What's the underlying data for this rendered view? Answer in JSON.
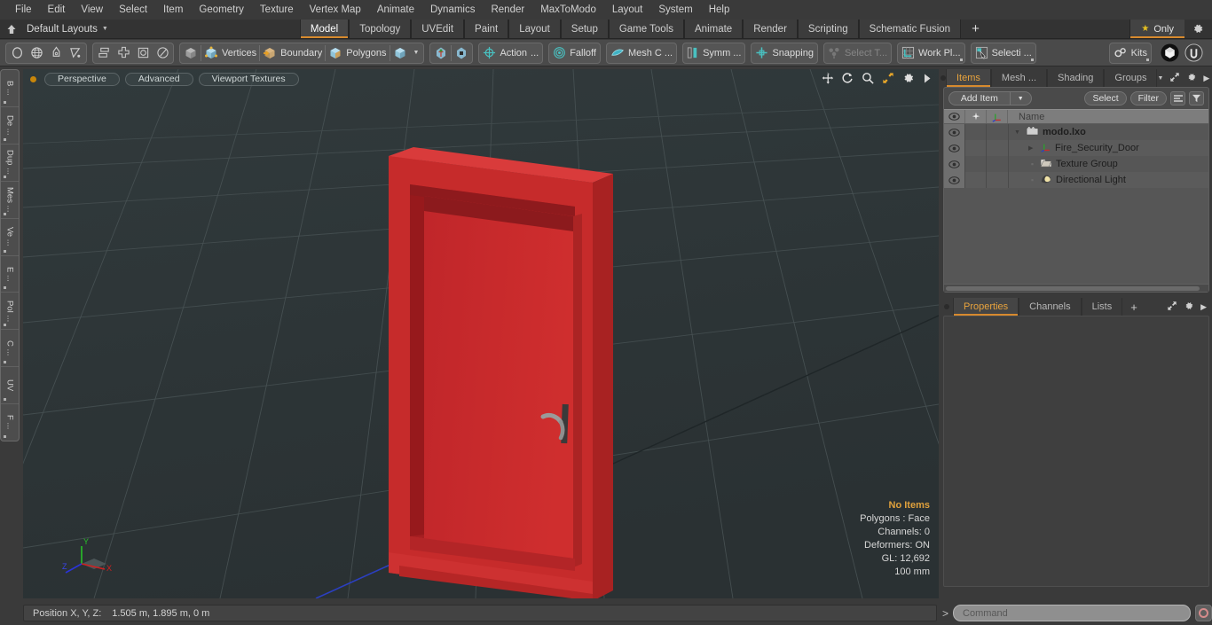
{
  "app": {
    "title": "modo",
    "accent": "#d78a2e",
    "viewport_bg": "#2e3638",
    "model_red": "#cc2a2a"
  },
  "menubar": {
    "items": [
      {
        "label": "File"
      },
      {
        "label": "Edit"
      },
      {
        "label": "View"
      },
      {
        "label": "Select"
      },
      {
        "label": "Item"
      },
      {
        "label": "Geometry"
      },
      {
        "label": "Texture"
      },
      {
        "label": "Vertex Map"
      },
      {
        "label": "Animate"
      },
      {
        "label": "Dynamics"
      },
      {
        "label": "Render"
      },
      {
        "label": "MaxToModo"
      },
      {
        "label": "Layout"
      },
      {
        "label": "System"
      },
      {
        "label": "Help"
      }
    ]
  },
  "layoutbar": {
    "layouts_label": "Default Layouts",
    "tabs": [
      {
        "label": "Model",
        "active": true
      },
      {
        "label": "Topology",
        "active": false
      },
      {
        "label": "UVEdit",
        "active": false
      },
      {
        "label": "Paint",
        "active": false
      },
      {
        "label": "Layout",
        "active": false
      },
      {
        "label": "Setup",
        "active": false
      },
      {
        "label": "Game Tools",
        "active": false
      },
      {
        "label": "Animate",
        "active": false
      },
      {
        "label": "Render",
        "active": false
      },
      {
        "label": "Scripting",
        "active": false
      },
      {
        "label": "Schematic Fusion",
        "active": false
      }
    ],
    "add_tab_label": "+",
    "only_label": "Only"
  },
  "toolbar": {
    "shape_tools": [
      {
        "name": "ellipse-tool",
        "label": ""
      },
      {
        "name": "globe-tool",
        "label": ""
      },
      {
        "name": "pen-tool",
        "label": ""
      },
      {
        "name": "curve-tool",
        "label": ""
      }
    ],
    "arrange_tools": [
      {
        "name": "align-tool",
        "label": ""
      },
      {
        "name": "center-tool",
        "label": ""
      },
      {
        "name": "bound-tool",
        "label": ""
      },
      {
        "name": "radial-tool",
        "label": ""
      }
    ],
    "selection_modes": [
      {
        "name": "cube-mode",
        "label": ""
      },
      {
        "name": "vertices-mode",
        "label": "Vertices"
      },
      {
        "name": "boundary-mode",
        "label": "Boundary"
      },
      {
        "name": "polygons-mode",
        "label": "Polygons"
      },
      {
        "name": "items-mode",
        "label": ""
      }
    ],
    "buttons": [
      {
        "name": "action-center",
        "label": "Action",
        "suffix": "...",
        "dim": false
      },
      {
        "name": "falloff",
        "label": "Falloff",
        "suffix": "",
        "dim": false
      },
      {
        "name": "mesh-constraint",
        "label": "Mesh C ...",
        "suffix": "",
        "dim": false
      },
      {
        "name": "symmetry",
        "label": "Symm ...",
        "suffix": "",
        "dim": false
      },
      {
        "name": "snapping",
        "label": "Snapping",
        "suffix": "",
        "dim": false
      },
      {
        "name": "select-through",
        "label": "Select T...",
        "suffix": "",
        "dim": true
      },
      {
        "name": "work-plane",
        "label": "Work Pl...",
        "suffix": "",
        "dim": false
      },
      {
        "name": "selection-set",
        "label": "Selecti ...",
        "suffix": "",
        "dim": false
      },
      {
        "name": "kits",
        "label": "Kits",
        "suffix": "",
        "dim": false
      }
    ],
    "export_unity": "unity-icon",
    "export_unreal": "unreal-icon"
  },
  "left_tabs": [
    {
      "label": "B ..."
    },
    {
      "label": "De ..."
    },
    {
      "label": "Dup ..."
    },
    {
      "label": "Mes ..."
    },
    {
      "label": "Ve ..."
    },
    {
      "label": "E ..."
    },
    {
      "label": "Pol ..."
    },
    {
      "label": "C ..."
    },
    {
      "label": "UV"
    },
    {
      "label": "F ..."
    }
  ],
  "viewport": {
    "pills": [
      {
        "name": "perspective",
        "label": "Perspective"
      },
      {
        "name": "advanced",
        "label": "Advanced"
      },
      {
        "name": "viewport-textures",
        "label": "Viewport Textures"
      }
    ],
    "tools": [
      {
        "name": "pan-icon"
      },
      {
        "name": "rotate-icon"
      },
      {
        "name": "zoom-icon"
      },
      {
        "name": "fit-icon"
      },
      {
        "name": "gear-icon"
      },
      {
        "name": "expand-arrow-icon"
      }
    ],
    "stats": {
      "selection": "No Items",
      "polygons": "Polygons : Face",
      "channels": "Channels: 0",
      "deformers": "Deformers: ON",
      "gl": "GL: 12,692",
      "scale": "100 mm"
    },
    "axes": {
      "x": "X",
      "y": "Y",
      "z": "Z"
    }
  },
  "right_panel": {
    "top_tabs": [
      {
        "label": "Items",
        "active": true
      },
      {
        "label": "Mesh ...",
        "active": false
      },
      {
        "label": "Shading",
        "active": false
      },
      {
        "label": "Groups",
        "active": false
      }
    ],
    "item_toolbar": {
      "add_item": "Add Item",
      "select": "Select",
      "filter": "Filter"
    },
    "tree_header": {
      "name_col": "Name"
    },
    "tree": [
      {
        "label": "modo.lxo",
        "icon": "scene-icon",
        "depth": 0,
        "bold": true,
        "expander": "down"
      },
      {
        "label": "Fire_Security_Door",
        "icon": "mesh-axis-icon",
        "depth": 1,
        "bold": false,
        "expander": "right"
      },
      {
        "label": "Texture Group",
        "icon": "texture-group-icon",
        "depth": 1,
        "bold": false,
        "expander": "none"
      },
      {
        "label": "Directional Light",
        "icon": "light-icon",
        "depth": 1,
        "bold": false,
        "expander": "none"
      }
    ],
    "bottom_tabs": [
      {
        "label": "Properties",
        "active": true
      },
      {
        "label": "Channels",
        "active": false
      },
      {
        "label": "Lists",
        "active": false
      }
    ],
    "bottom_add_tab": "+"
  },
  "statusbar": {
    "position_label": "Position X, Y, Z:",
    "position_value": "1.505 m, 1.895 m, 0 m",
    "command_placeholder": "Command",
    "command_value": "",
    "prompt": ">"
  }
}
